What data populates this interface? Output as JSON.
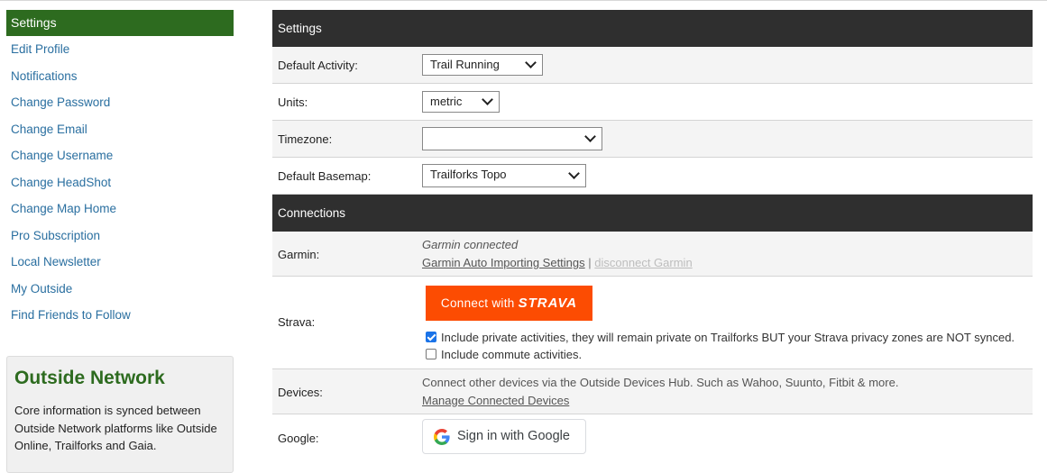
{
  "sidebar": {
    "active": "Settings",
    "items": [
      "Edit Profile",
      "Notifications",
      "Change Password",
      "Change Email",
      "Change Username",
      "Change HeadShot",
      "Change Map Home",
      "Pro Subscription",
      "Local Newsletter",
      "My Outside",
      "Find Friends to Follow"
    ]
  },
  "outside_network": {
    "title": "Outside Network",
    "text": "Core information is synced between Outside Network platforms like Outside Online, Trailforks and Gaia."
  },
  "settings": {
    "header": "Settings",
    "default_activity": {
      "label": "Default Activity:",
      "value": "Trail Running"
    },
    "units": {
      "label": "Units:",
      "value": "metric"
    },
    "timezone": {
      "label": "Timezone:",
      "value": ""
    },
    "basemap": {
      "label": "Default Basemap:",
      "value": "Trailforks Topo"
    }
  },
  "connections": {
    "header": "Connections",
    "garmin": {
      "label": "Garmin:",
      "status": "Garmin connected",
      "settings_link": "Garmin Auto Importing Settings",
      "separator": "|",
      "disconnect_link": "disconnect Garmin"
    },
    "strava": {
      "label": "Strava:",
      "button_prefix": "Connect with",
      "button_brand": "STRAVA",
      "private_label": "Include private activities, they will remain private on Trailforks BUT your Strava privacy zones are NOT synced.",
      "private_checked": true,
      "commute_label": "Include commute activities.",
      "commute_checked": false
    },
    "devices": {
      "label": "Devices:",
      "text": "Connect other devices via the Outside Devices Hub. Such as Wahoo, Suunto, Fitbit & more.",
      "link": "Manage Connected Devices"
    },
    "google": {
      "label": "Google:",
      "button": "Sign in with Google"
    }
  },
  "colors": {
    "active_bg": "#2d6b1f",
    "header_bg": "#2f2f2f",
    "strava": "#fc4c02",
    "link": "#2a6fa0"
  }
}
